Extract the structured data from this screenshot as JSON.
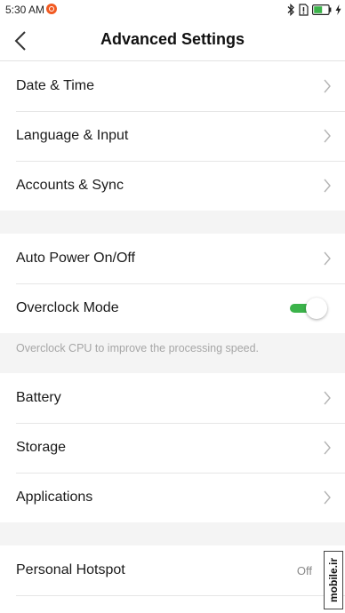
{
  "status_bar": {
    "time": "5:30 AM",
    "icons": [
      "app-notification-icon",
      "bluetooth-icon",
      "sim-icon",
      "battery-icon",
      "charging-icon"
    ],
    "battery_color": "#3bb34a"
  },
  "header": {
    "title": "Advanced Settings",
    "back_icon": "chevron-left-icon"
  },
  "groups": [
    {
      "rows": [
        {
          "label": "Date & Time"
        },
        {
          "label": "Language & Input"
        },
        {
          "label": "Accounts & Sync"
        }
      ]
    },
    {
      "rows": [
        {
          "label": "Auto Power On/Off"
        },
        {
          "label": "Overclock Mode",
          "toggle_on": true
        }
      ],
      "hint": "Overclock CPU to improve the processing speed."
    },
    {
      "rows": [
        {
          "label": "Battery"
        },
        {
          "label": "Storage"
        },
        {
          "label": "Applications"
        }
      ]
    },
    {
      "rows": [
        {
          "label": "Personal Hotspot",
          "value": "Off"
        }
      ]
    }
  ],
  "watermark": "mobile.ir",
  "colors": {
    "accent_green": "#3bb34a",
    "page_background": "#f4f4f4",
    "chevron": "#b3b3b3"
  }
}
